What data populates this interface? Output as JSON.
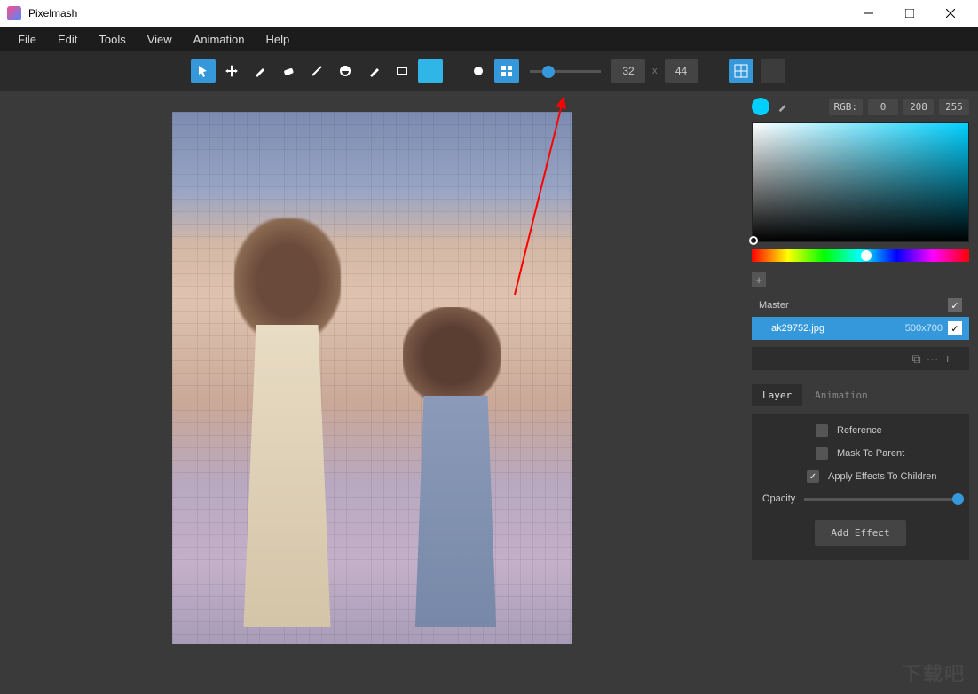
{
  "titlebar": {
    "app_name": "Pixelmash"
  },
  "menubar": {
    "items": [
      "File",
      "Edit",
      "Tools",
      "View",
      "Animation",
      "Help"
    ]
  },
  "toolbar": {
    "tools": [
      {
        "name": "pointer-tool",
        "active": true
      },
      {
        "name": "move-tool",
        "active": false
      },
      {
        "name": "brush-tool",
        "active": false
      },
      {
        "name": "eraser-tool",
        "active": false
      },
      {
        "name": "line-tool",
        "active": false
      },
      {
        "name": "ellipse-tool",
        "active": false
      },
      {
        "name": "fill-tool",
        "active": false
      },
      {
        "name": "rectangle-tool",
        "active": false
      }
    ],
    "color_swatch": "#2fb6e6",
    "shape_mode": [
      {
        "name": "round-brush",
        "active": false
      },
      {
        "name": "square-brush",
        "active": true
      }
    ],
    "size_slider_pct": 18,
    "dims_w": "32",
    "dims_x": "x",
    "dims_h": "44"
  },
  "colorpanel": {
    "current": "#00d0ff",
    "rgb_label": "RGB:",
    "r": "0",
    "g": "208",
    "b": "255",
    "hue_pct": 50,
    "sv_bg": "#00d0ff"
  },
  "layers": {
    "master": "Master",
    "rows": [
      {
        "name": "ak29752.jpg",
        "dims": "500x700",
        "selected": true
      }
    ]
  },
  "tabs": {
    "layer": "Layer",
    "animation": "Animation"
  },
  "props": {
    "reference": "Reference",
    "mask": "Mask To Parent",
    "apply": "Apply Effects To Children",
    "opacity_label": "Opacity",
    "add_effect": "Add Effect"
  },
  "watermark": "下载吧"
}
